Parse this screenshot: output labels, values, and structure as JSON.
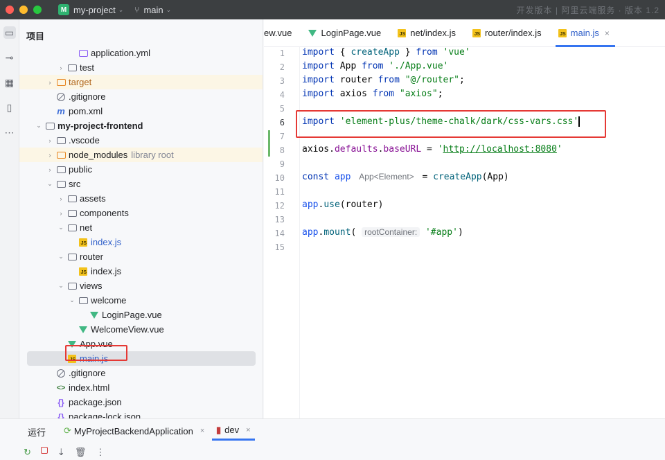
{
  "titlebar": {
    "project_badge": "M",
    "project_name": "my-project",
    "branch_name": "main",
    "faded_text": "开发版本 | 阿里云端服务  ·  版本 1.2"
  },
  "project_panel": {
    "title": "项目",
    "rows": [
      {
        "label": "application.yml",
        "icon": "yaml-icon",
        "level": 4,
        "chev": ""
      },
      {
        "label": "test",
        "icon": "folder-icon",
        "level": 3,
        "chev": "›"
      },
      {
        "label": "target",
        "icon": "folder-orange-icon",
        "level": 2,
        "chev": "›",
        "style": "orange"
      },
      {
        "label": ".gitignore",
        "icon": "ignore-icon",
        "level": 2,
        "chev": ""
      },
      {
        "label": "pom.xml",
        "icon": "maven-icon",
        "level": 2,
        "chev": ""
      },
      {
        "label": "my-project-frontend",
        "icon": "folder-icon",
        "level": 1,
        "chev": "⌄",
        "style": "bold"
      },
      {
        "label": ".vscode",
        "icon": "folder-icon",
        "level": 2,
        "chev": "›"
      },
      {
        "label": "node_modules",
        "icon": "folder-orange-icon",
        "level": 2,
        "chev": "›",
        "suffix": "library root"
      },
      {
        "label": "public",
        "icon": "folder-icon",
        "level": 2,
        "chev": "›"
      },
      {
        "label": "src",
        "icon": "folder-icon",
        "level": 2,
        "chev": "⌄"
      },
      {
        "label": "assets",
        "icon": "folder-icon",
        "level": 3,
        "chev": "›"
      },
      {
        "label": "components",
        "icon": "folder-icon",
        "level": 3,
        "chev": "›"
      },
      {
        "label": "net",
        "icon": "folder-icon",
        "level": 3,
        "chev": "⌄"
      },
      {
        "label": "index.js",
        "icon": "js-icon",
        "level": 4,
        "chev": "",
        "style": "blue"
      },
      {
        "label": "router",
        "icon": "folder-icon",
        "level": 3,
        "chev": "⌄"
      },
      {
        "label": "index.js",
        "icon": "js-icon",
        "level": 4,
        "chev": ""
      },
      {
        "label": "views",
        "icon": "folder-icon",
        "level": 3,
        "chev": "⌄"
      },
      {
        "label": "welcome",
        "icon": "folder-icon",
        "level": 4,
        "chev": "⌄"
      },
      {
        "label": "LoginPage.vue",
        "icon": "vue-icon",
        "level": 5,
        "chev": ""
      },
      {
        "label": "WelcomeView.vue",
        "icon": "vue-icon",
        "level": 4,
        "chev": ""
      },
      {
        "label": "App.vue",
        "icon": "vue-icon",
        "level": 3,
        "chev": ""
      },
      {
        "label": "main.js",
        "icon": "js-icon",
        "level": 3,
        "chev": "",
        "style": "blue",
        "selected": true
      },
      {
        "label": ".gitignore",
        "icon": "ignore-icon",
        "level": 2,
        "chev": ""
      },
      {
        "label": "index.html",
        "icon": "html-icon",
        "level": 2,
        "chev": ""
      },
      {
        "label": "package.json",
        "icon": "json-icon",
        "level": 2,
        "chev": ""
      },
      {
        "label": "package-lock.json",
        "icon": "json-icon",
        "level": 2,
        "chev": ""
      }
    ]
  },
  "editor": {
    "tabs": [
      {
        "label": "ew.vue",
        "icon": "vue-icon"
      },
      {
        "label": "LoginPage.vue",
        "icon": "vue-icon"
      },
      {
        "label": "net/index.js",
        "icon": "js-icon"
      },
      {
        "label": "router/index.js",
        "icon": "js-icon"
      },
      {
        "label": "main.js",
        "icon": "js-icon",
        "active": true,
        "close": "×"
      }
    ],
    "line_numbers": [
      "1",
      "2",
      "3",
      "4",
      "5",
      "6",
      "7",
      "8",
      "9",
      "10",
      "11",
      "12",
      "13",
      "14",
      "15"
    ],
    "current_line": "6",
    "lines": {
      "l1": {
        "kw1": "import",
        "p1": " { ",
        "fn": "createApp",
        "p2": " } ",
        "kw2": "from",
        "str": "'vue'"
      },
      "l2": {
        "kw1": "import",
        "p1": " App ",
        "kw2": "from",
        "str": "'./App.vue'"
      },
      "l3": {
        "kw1": "import",
        "p1": " router ",
        "kw2": "from",
        "str": "\"@/router\"",
        "end": ";"
      },
      "l4": {
        "kw1": "import",
        "p1": " axios ",
        "kw2": "from",
        "str": "\"axios\"",
        "end": ";"
      },
      "l6": {
        "kw1": "import",
        "str": "'element-plus/theme-chalk/dark/css-vars.css'"
      },
      "l8": {
        "obj": "axios",
        "p1": ".",
        "prop1": "defaults",
        "p2": ".",
        "prop2": "baseURL",
        "p3": " = ",
        "q1": "'",
        "url": "http://localhost:8080",
        "q2": "'"
      },
      "l10": {
        "kw1": "const",
        "var": "app",
        "hint": "App<Element>",
        "p1": " = ",
        "fn": "createApp",
        "p2": "(App)"
      },
      "l12": {
        "var": "app",
        "p1": ".",
        "fn": "use",
        "p2": "(",
        "arg": "router",
        "p3": ")"
      },
      "l14": {
        "var": "app",
        "p1": ".",
        "fn": "mount",
        "p2": "(",
        "hint": "rootContainer:",
        "str": "'#app'",
        "p3": ")"
      }
    }
  },
  "bottom": {
    "run_label": "运行",
    "tabs": [
      {
        "label": "MyProjectBackendApplication",
        "close": "×"
      },
      {
        "label": "dev",
        "close": "×",
        "active": true
      }
    ]
  },
  "colors": {
    "highlight_box": "#e53935",
    "accent": "#3574f0",
    "vue": "#41b883",
    "js": "#f3c21b"
  }
}
